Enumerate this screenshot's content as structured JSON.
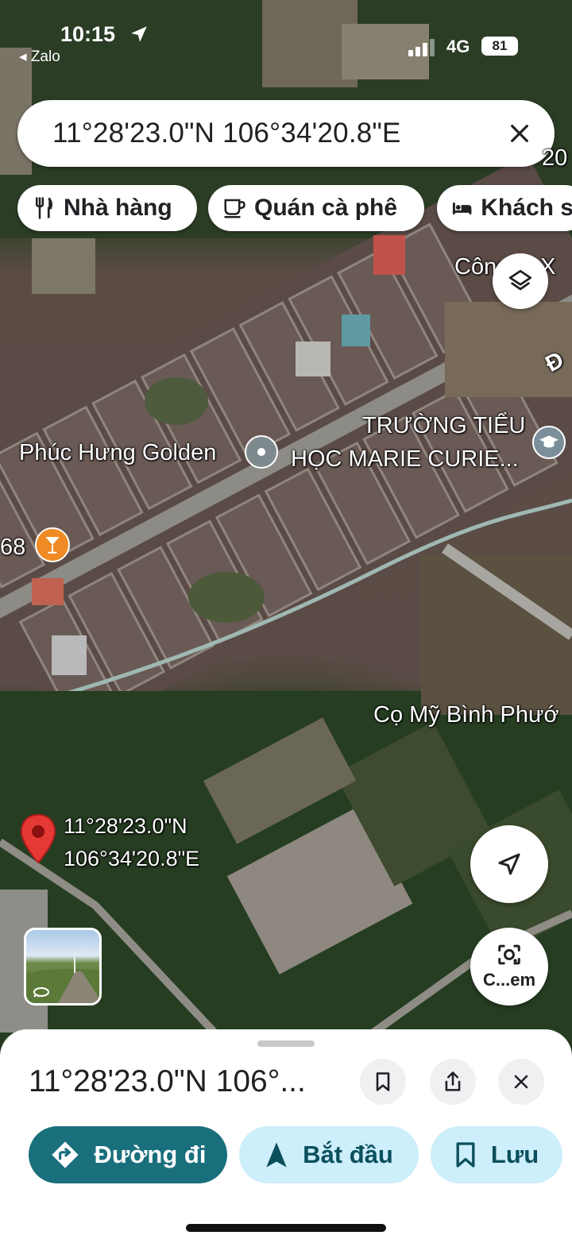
{
  "status_bar": {
    "time": "10:15",
    "back_app": "Zalo",
    "network": "4G",
    "battery": "81"
  },
  "search": {
    "query": "11°28'23.0\"N 106°34'20.8\"E"
  },
  "chips": [
    {
      "label": "Nhà hàng",
      "icon": "fork-knife-icon"
    },
    {
      "label": "Quán cà phê",
      "icon": "coffee-cup-icon"
    },
    {
      "label": "Khách s",
      "icon": "bed-icon"
    }
  ],
  "map_labels": {
    "road_top": "20",
    "company": "Công ty X",
    "road_right": "Đ",
    "place_golden": "Phúc Hưng Golden",
    "school_line1": "TRƯỜNG TIỂU",
    "school_line2": "HỌC MARIE CURIE...",
    "bar_num": "68",
    "palm": "Cọ Mỹ Bình Phướ",
    "pin_lat": "11°28'23.0\"N",
    "pin_lng": "106°34'20.8\"E"
  },
  "fabs": {
    "camera_label": "C...em"
  },
  "sheet": {
    "title": "11°28'23.0\"N 106°...",
    "directions_label": "Đường đi",
    "start_label": "Bắt đầu",
    "save_label": "Lưu"
  },
  "colors": {
    "accent_teal": "#1a6f7d",
    "start_bg": "#cdeefb",
    "pin_red": "#e53935"
  }
}
